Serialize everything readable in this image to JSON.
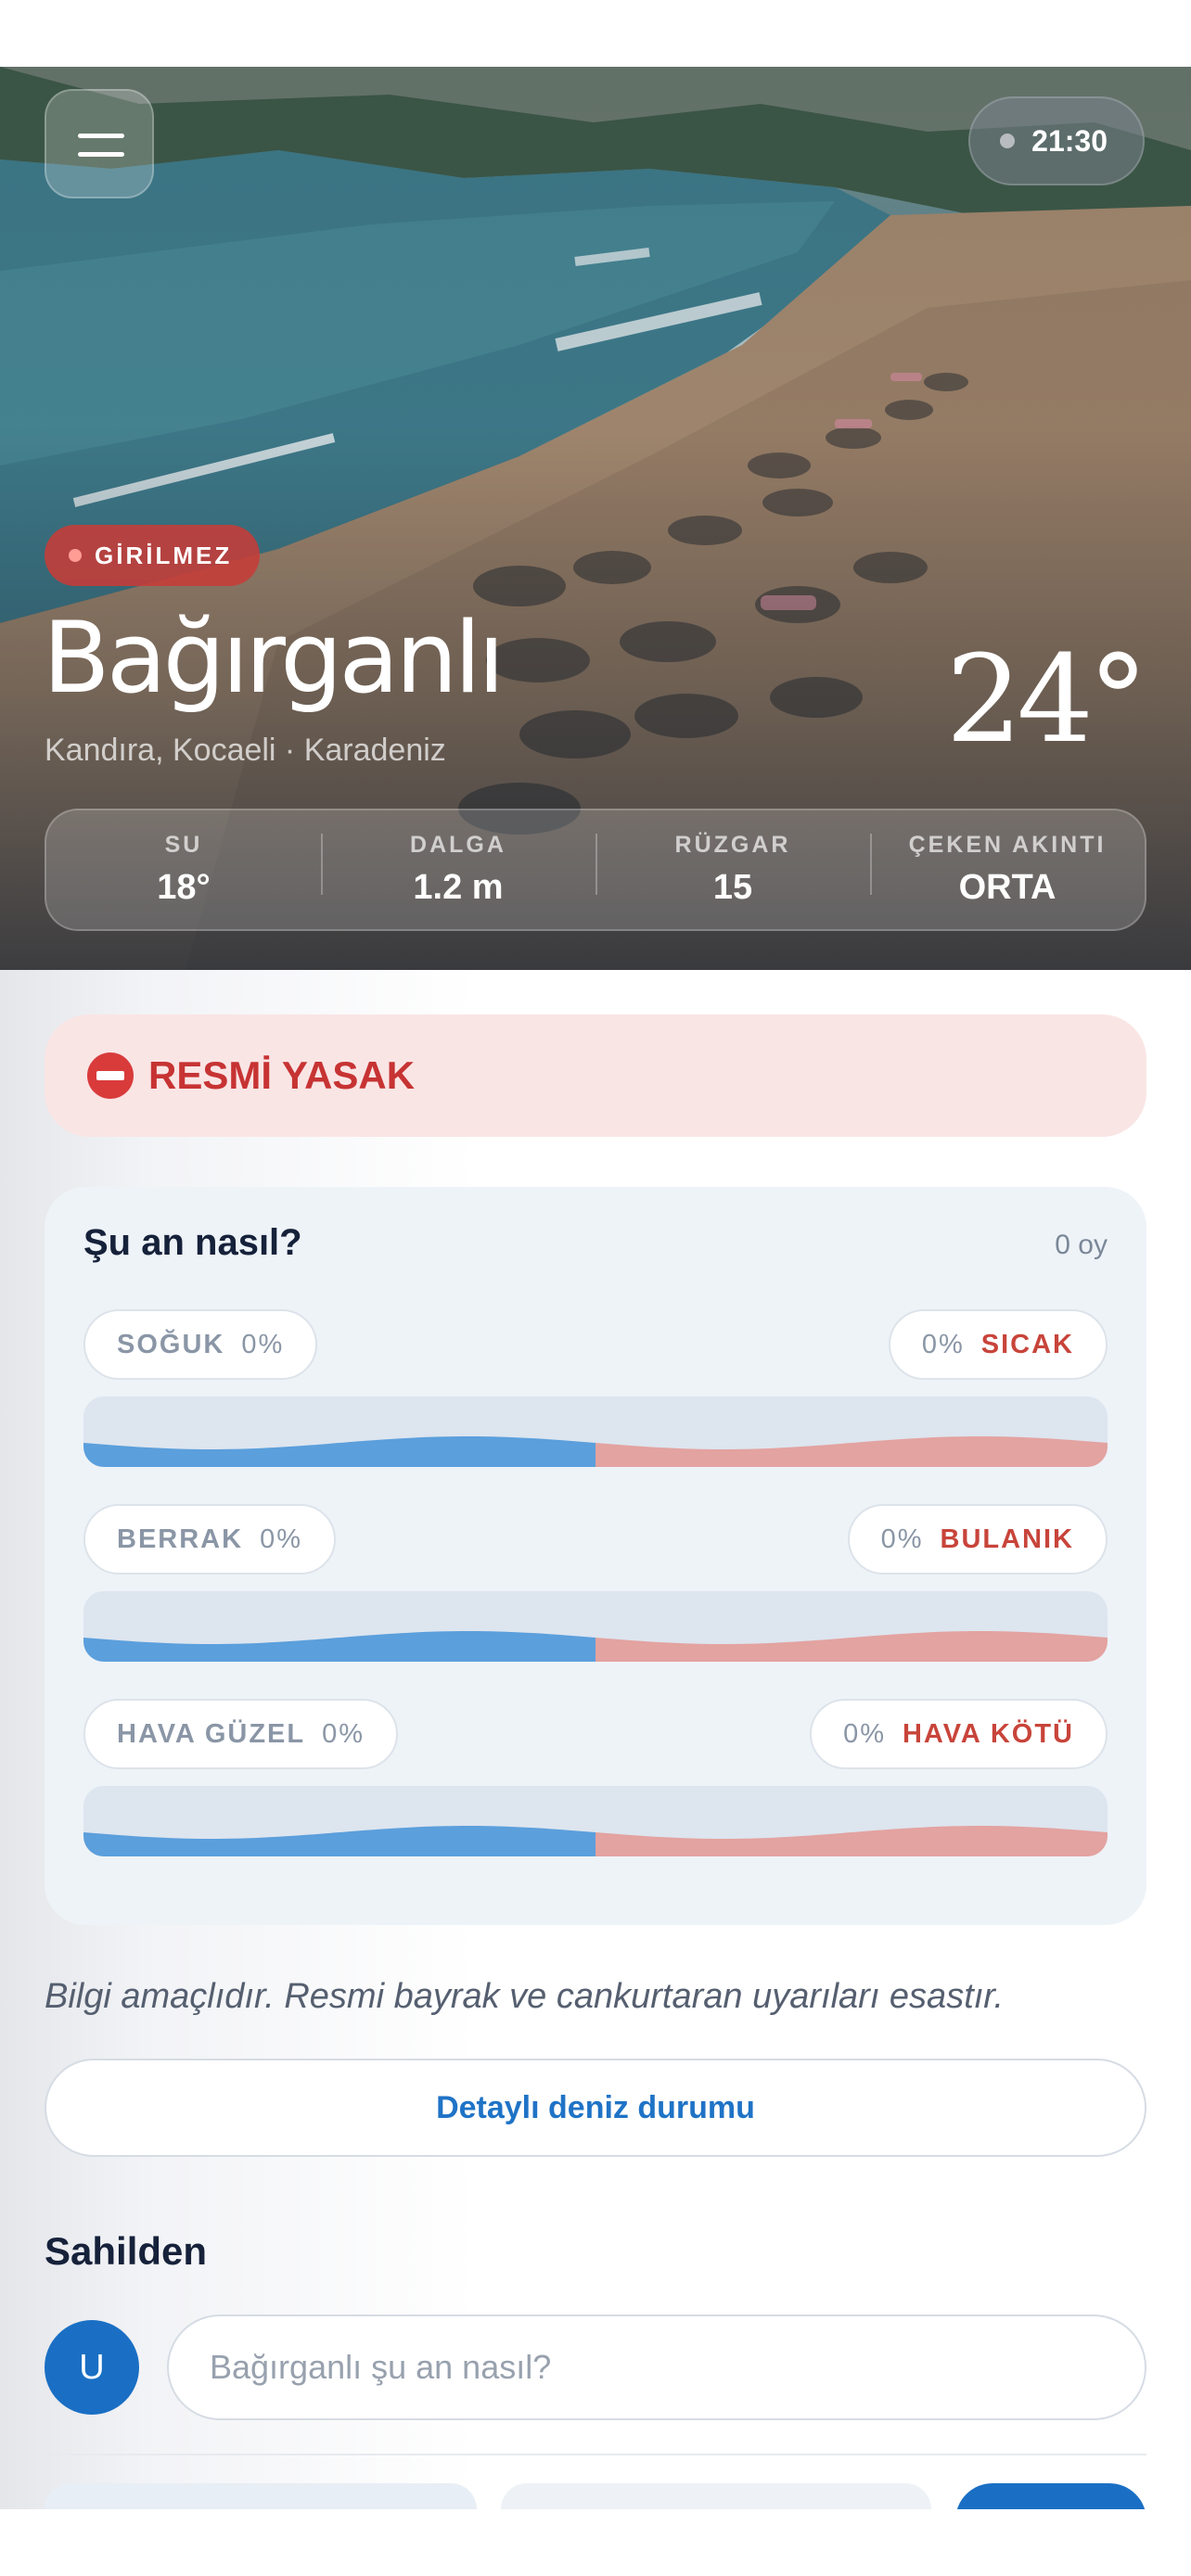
{
  "header": {
    "time": "21:30"
  },
  "beach": {
    "status_badge": "GİRİLMEZ",
    "name": "Bağırganlı",
    "location": "Kandıra, Kocaeli · Karadeniz",
    "temperature": "24°"
  },
  "stats": [
    {
      "label": "SU",
      "value": "18°"
    },
    {
      "label": "DALGA",
      "value": "1.2 m"
    },
    {
      "label": "RÜZGAR",
      "value": "15"
    },
    {
      "label": "ÇEKEN AKINTI",
      "value": "ORTA"
    }
  ],
  "ban": {
    "text": "RESMİ YASAK"
  },
  "poll": {
    "title": "Şu an nasıl?",
    "vote_count": "0 oy",
    "rows": [
      {
        "left_label": "SOĞUK",
        "left_pct": "0%",
        "right_pct": "0%",
        "right_label": "SICAK",
        "left_share": 0.5
      },
      {
        "left_label": "BERRAK",
        "left_pct": "0%",
        "right_pct": "0%",
        "right_label": "BULANIK",
        "left_share": 0.5
      },
      {
        "left_label": "HAVA GÜZEL",
        "left_pct": "0%",
        "right_pct": "0%",
        "right_label": "HAVA KÖTÜ",
        "left_share": 0.5
      }
    ]
  },
  "disclaimer": "Bilgi amaçlıdır. Resmi bayrak ve cankurtaran uyarıları esastır.",
  "detail_button": "Detaylı deniz durumu",
  "comments": {
    "section_title": "Sahilden",
    "avatar_initial": "U",
    "input_placeholder": "Bağırganlı şu an nasıl?"
  },
  "colors": {
    "danger": "#c73333",
    "accent_blue": "#1a6fc4",
    "wave_cold": "#5b9fdc",
    "wave_hot": "#e3a3a0"
  }
}
